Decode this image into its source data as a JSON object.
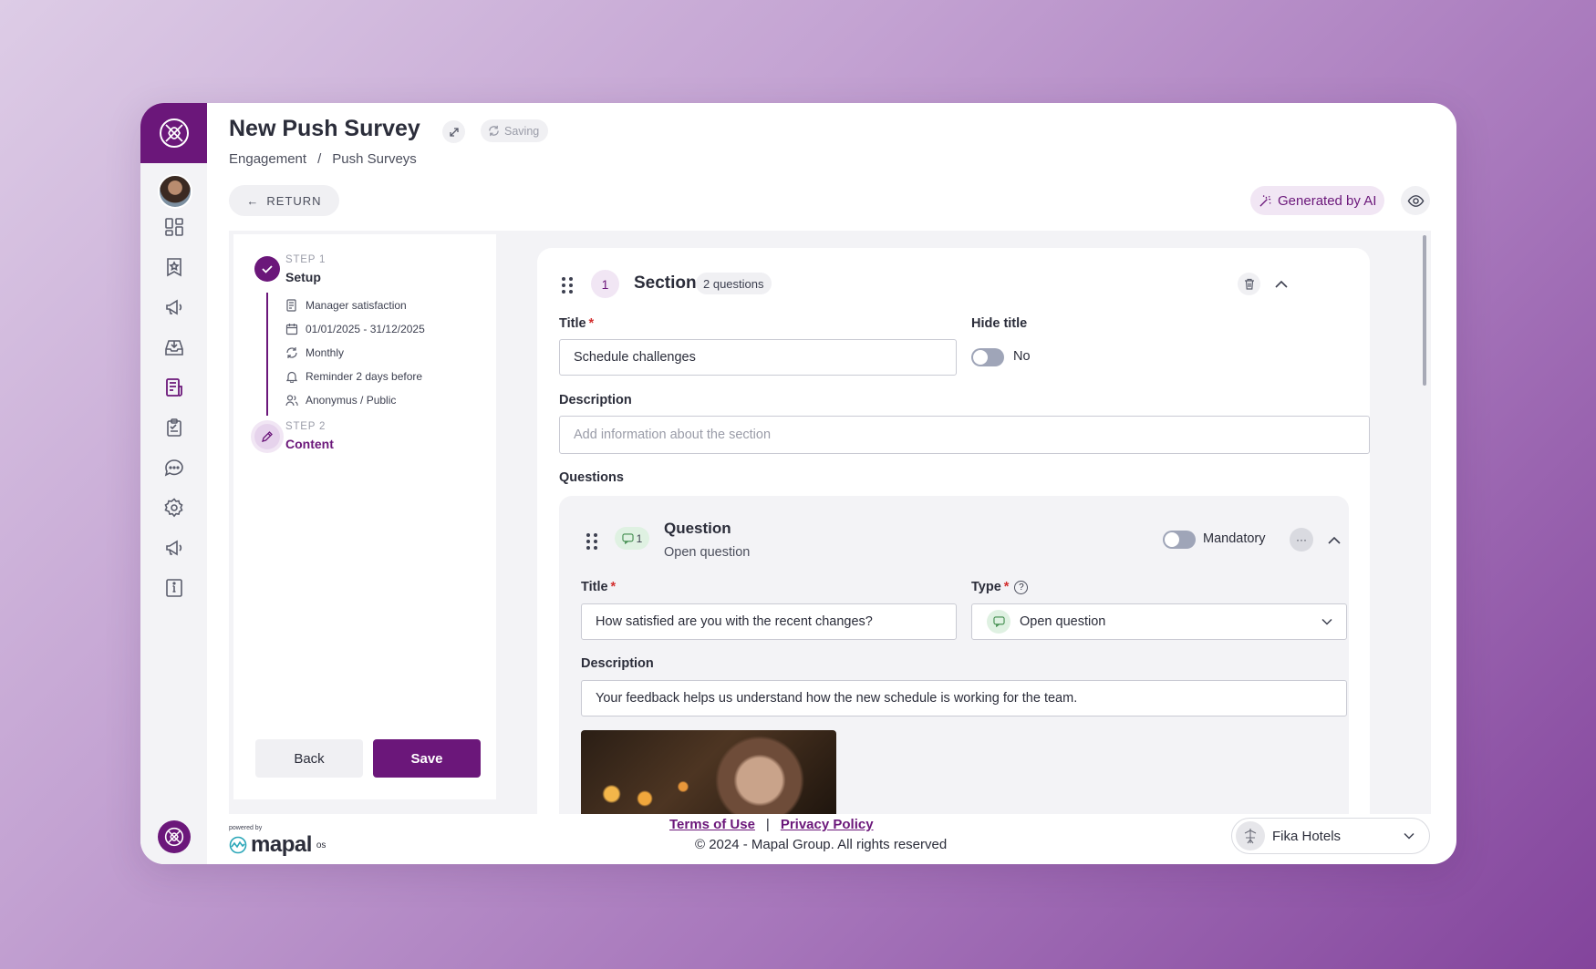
{
  "header": {
    "title": "New Push Survey",
    "saving_label": "Saving",
    "breadcrumb": [
      "Engagement",
      "/",
      "Push Surveys"
    ],
    "return_label": "RETURN",
    "ai_label": "Generated by AI"
  },
  "steps": {
    "step1_kicker": "STEP 1",
    "step1_name": "Setup",
    "details": [
      {
        "icon": "survey-icon",
        "text": "Manager satisfaction"
      },
      {
        "icon": "calendar-icon",
        "text": "01/01/2025 - 31/12/2025"
      },
      {
        "icon": "refresh-icon",
        "text": "Monthly"
      },
      {
        "icon": "bell-icon",
        "text": "Reminder 2 days before"
      },
      {
        "icon": "users-icon",
        "text": "Anonymus / Public"
      }
    ],
    "step2_kicker": "STEP 2",
    "step2_name": "Content",
    "back_label": "Back",
    "save_label": "Save"
  },
  "section": {
    "number": "1",
    "title": "Section",
    "count": "2 questions",
    "title_label": "Title",
    "title_value": "Schedule challenges",
    "hide_title_label": "Hide title",
    "hide_title_value": "No",
    "description_label": "Description",
    "description_placeholder": "Add information about the section",
    "questions_label": "Questions"
  },
  "question": {
    "number": "1",
    "title": "Question",
    "subtitle": "Open question",
    "mandatory_label": "Mandatory",
    "more_label": "···",
    "title_label": "Title",
    "title_value": "How satisfied are you with the recent changes?",
    "type_label": "Type",
    "type_help": "?",
    "type_value": "Open question",
    "description_label": "Description",
    "description_value": "Your feedback helps us understand how the new schedule is working for the team."
  },
  "footer": {
    "powered_by": "powered by",
    "brand": "mapal",
    "brand_suffix": "os",
    "terms": "Terms of Use",
    "separator": "|",
    "privacy": "Privacy Policy",
    "copyright": "© 2024 - Mapal Group. All rights reserved",
    "org": "Fika Hotels"
  },
  "colors": {
    "brand": "#6b177a",
    "brand_light": "#f1e6f4",
    "required": "#d32f2f"
  }
}
